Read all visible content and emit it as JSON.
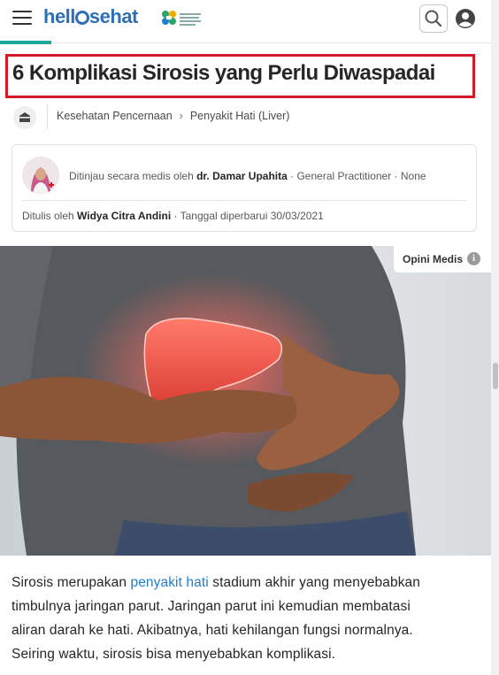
{
  "header": {
    "logo_prefix": "hell",
    "logo_suffix": "sehat",
    "partner_logo": "kementerian-kesehatan-logo",
    "icons": {
      "menu": "hamburger-icon",
      "search": "search-icon",
      "profile": "user-profile-icon"
    },
    "accent_color": "#1ba99c"
  },
  "article": {
    "title": "6 Komplikasi Sirosis yang Perlu Diwaspadai",
    "highlight_color": "#d5172a",
    "category_icon": "digestive-category-icon",
    "breadcrumb": [
      "Kesehatan Pencernaan",
      "Penyakit Hati (Liver)"
    ],
    "breadcrumb_separator": "›",
    "reviewer": {
      "prefix": "Ditinjau secara medis oleh",
      "name": "dr. Damar Upahita",
      "suffix": "· General Practitioner · None"
    },
    "writer": {
      "prefix": "Ditulis oleh",
      "name": "Widya Citra Andini",
      "suffix": "· Tanggal diperbarui 30/03/2021"
    },
    "image_badge": {
      "label": "Opini Medis",
      "icon": "info-icon"
    },
    "body": {
      "line1_before": "Sirosis merupakan ",
      "link_text": "penyakit hati",
      "line1_after": " stadium akhir yang menyebabkan",
      "line2": "timbulnya jaringan parut. Jaringan parut ini kemudian membatasi",
      "line3": "aliran darah ke hati. Akibatnya, hati kehilangan fungsi normalnya.",
      "line4": "Seiring waktu, sirosis bisa menyebabkan komplikasi."
    },
    "link_color": "#1e7fd1"
  }
}
